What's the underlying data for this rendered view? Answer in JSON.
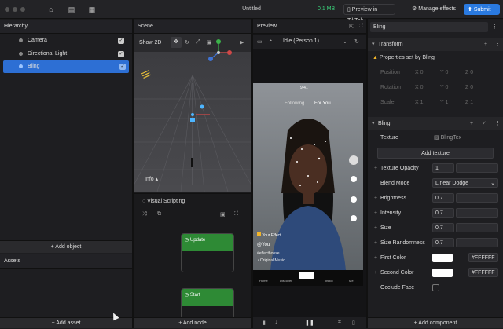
{
  "topbar": {
    "title": "Untitled",
    "size": "0.1 MB",
    "preview_tiktok": "Preview in TikTok",
    "manage_effects": "Manage effects",
    "submit": "Submit"
  },
  "hierarchy": {
    "title": "Hierarchy",
    "items": [
      {
        "label": "Camera"
      },
      {
        "label": "Directional Light"
      },
      {
        "label": "Bling"
      }
    ],
    "add_object": "+ Add object"
  },
  "assets": {
    "title": "Assets",
    "add_asset": "+ Add asset"
  },
  "scene": {
    "title": "Scene",
    "show2d": "Show 2D",
    "info": "Info"
  },
  "visual_scripting": {
    "title": "Visual Scripting",
    "nodes": [
      {
        "label": "Update"
      },
      {
        "label": "Start"
      }
    ],
    "add_node": "+ Add node"
  },
  "preview": {
    "title": "Preview",
    "mode": "Idle (Person 1)",
    "time": "9:41",
    "following": "Following",
    "for_you": "For You",
    "your_effect": "Your Effect",
    "user": "@You",
    "hashtag": "#effecthouse",
    "music": "Original Music",
    "nav": [
      "Home",
      "Discover",
      "",
      "Inbox",
      "Me"
    ]
  },
  "inspector": {
    "name": "Bling",
    "transform": {
      "title": "Transform",
      "warning": "Properties set by Bling",
      "position": "Position",
      "rotation": "Rotation",
      "scale": "Scale",
      "pos_vals": [
        "0",
        "0",
        "0"
      ],
      "rot_vals": [
        "0",
        "0",
        "0"
      ],
      "scale_vals": [
        "1",
        "1",
        "1"
      ]
    },
    "bling": {
      "title": "Bling",
      "texture_label": "Texture",
      "texture_val": "BlingTex",
      "add_texture": "Add texture",
      "texture_opacity": "Texture Opacity",
      "texture_opacity_val": "1",
      "blend_mode": "Blend Mode",
      "blend_mode_val": "Linear Dodge",
      "brightness": "Brightness",
      "brightness_val": "0.7",
      "intensity": "Intensity",
      "intensity_val": "0.7",
      "size": "Size",
      "size_val": "0.7",
      "size_randomness": "Size Randomness",
      "size_randomness_val": "0.7",
      "first_color": "First Color",
      "first_color_val": "#FFFFFF",
      "second_color": "Second Color",
      "second_color_val": "#FFFFFF",
      "occlude_face": "Occlude Face"
    },
    "add_component": "+ Add component"
  },
  "colors": {
    "accent": "#2a7ae0",
    "selection": "#2d6fd4",
    "node": "#2e8a35",
    "size_text": "#3ad07a"
  }
}
